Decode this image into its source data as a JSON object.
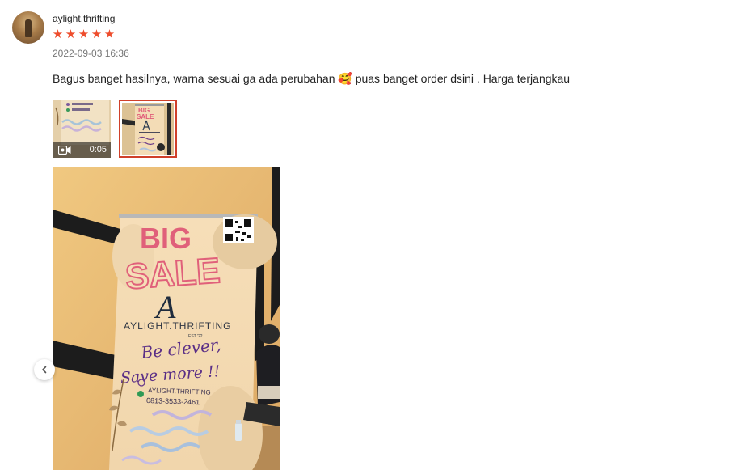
{
  "review": {
    "username": "aylight.thrifting",
    "rating": 5,
    "stars": [
      "★",
      "★",
      "★",
      "★",
      "★"
    ],
    "timestamp": "2022-09-03 16:36",
    "comment_before": "Bagus banget hasilnya, warna sesuai ga ada perubahan",
    "comment_emoji": "🥰",
    "comment_after": "puas banget order dsini . Harga terjangkau"
  },
  "media": {
    "video_duration": "0:05",
    "video_icon": "video-camera-icon",
    "selected_thumbnail": 2
  },
  "photo": {
    "banner_title_1": "BIG",
    "banner_title_2": "SALE",
    "brand_logo": "A",
    "brand_name": "AYLIGHT.THRIFTING",
    "brand_est": "EST '22",
    "slogan_1": "Be clever,",
    "slogan_2": "Save more !!",
    "instagram": "AYLIGHT.THRIFTING",
    "phone": "0813-3533-2461"
  },
  "colors": {
    "star": "#ee4d2d",
    "selected_border": "#d0402a"
  },
  "controls": {
    "prev_icon": "chevron-left-icon"
  }
}
